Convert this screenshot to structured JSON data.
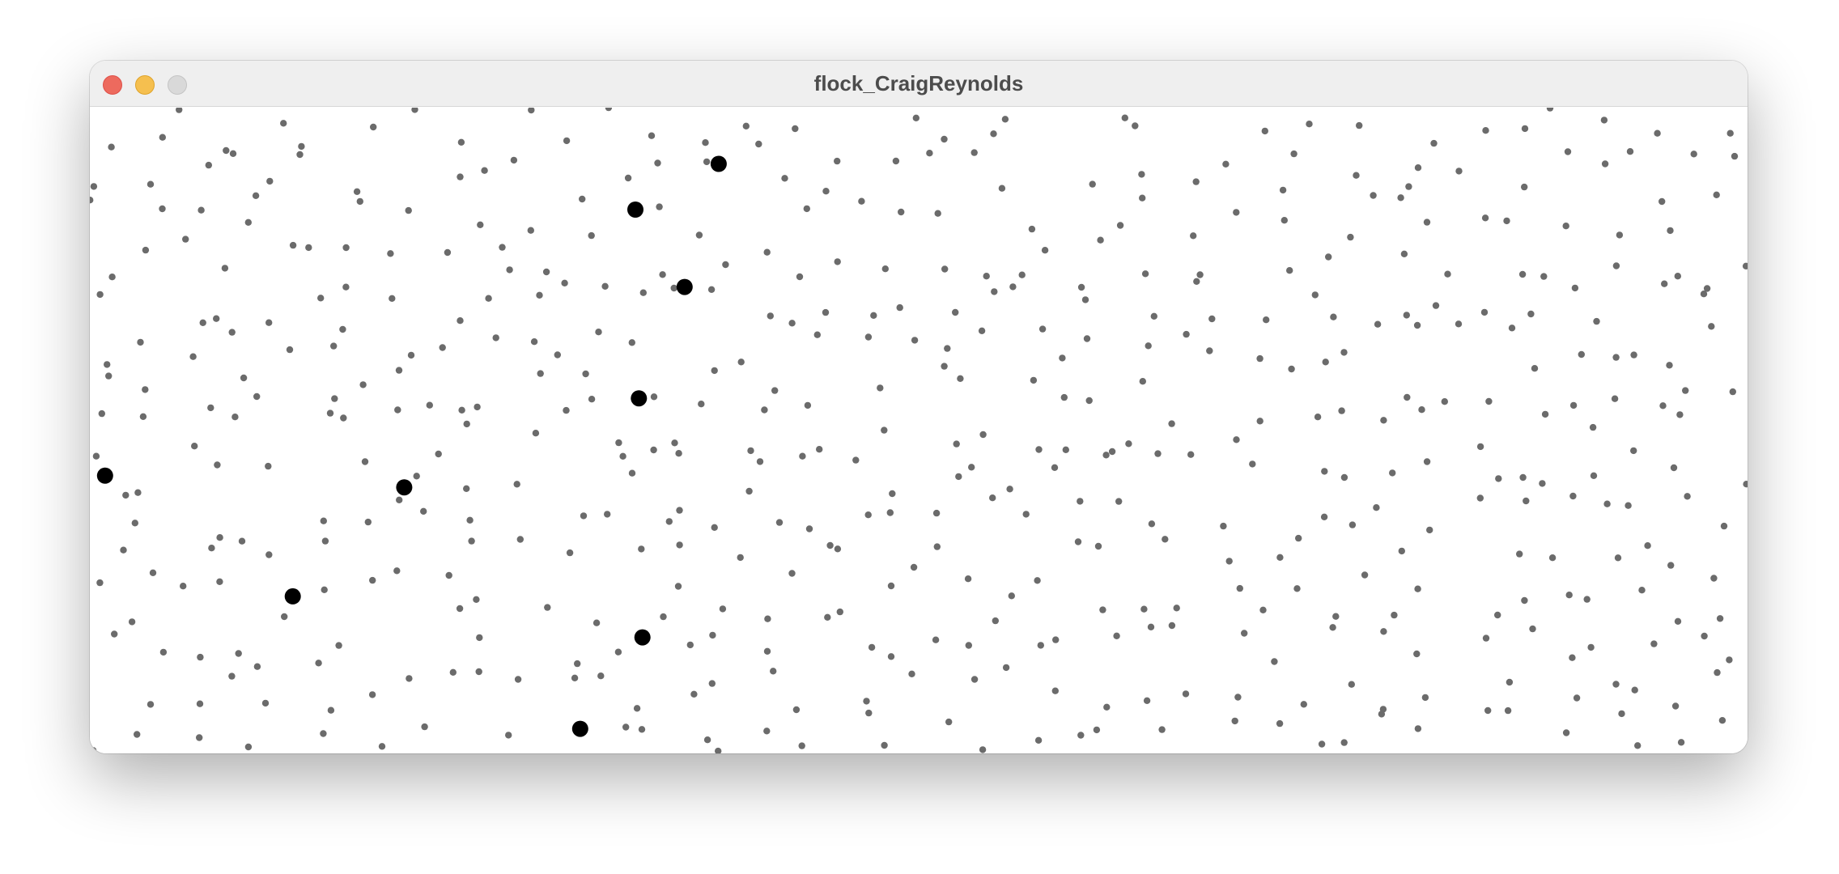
{
  "window": {
    "title": "flock_CraigReynolds",
    "controls": {
      "close_color": "#ed6a5e",
      "minimize_color": "#f5bf4f",
      "zoom_color": "#d9d9d9"
    }
  },
  "canvas": {
    "background": "#ffffff",
    "boid_color": "#6b6b6b",
    "highlight_color": "#000000"
  }
}
